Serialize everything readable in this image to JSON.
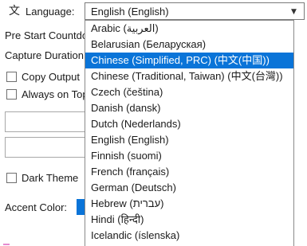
{
  "language": {
    "icon": "translate-icon",
    "label": "Language:",
    "selected_value": "English (English)",
    "options": [
      "Arabic (العربية)",
      "Belarusian (Беларуская)",
      "Chinese (Simplified, PRC) (中文(中国))",
      "Chinese (Traditional, Taiwan) (中文(台灣))",
      "Czech (čeština)",
      "Danish (dansk)",
      "Dutch (Nederlands)",
      "English (English)",
      "Finnish (suomi)",
      "French (français)",
      "German (Deutsch)",
      "Hebrew (עברית)",
      "Hindi (हिन्दी)",
      "Icelandic (íslenska)"
    ],
    "highlighted_option": "Chinese (Simplified, PRC) (中文(中国))"
  },
  "settings": {
    "pre_start_label": "Pre Start Countdown",
    "capture_duration_label": "Capture Duration",
    "copy_output_label": "Copy Output",
    "always_on_top_label": "Always on Top",
    "dark_theme_label": "Dark Theme",
    "accent_color_label": "Accent Color:"
  },
  "colors": {
    "accent": "#0a74d8",
    "highlight": "#0a74d8"
  }
}
